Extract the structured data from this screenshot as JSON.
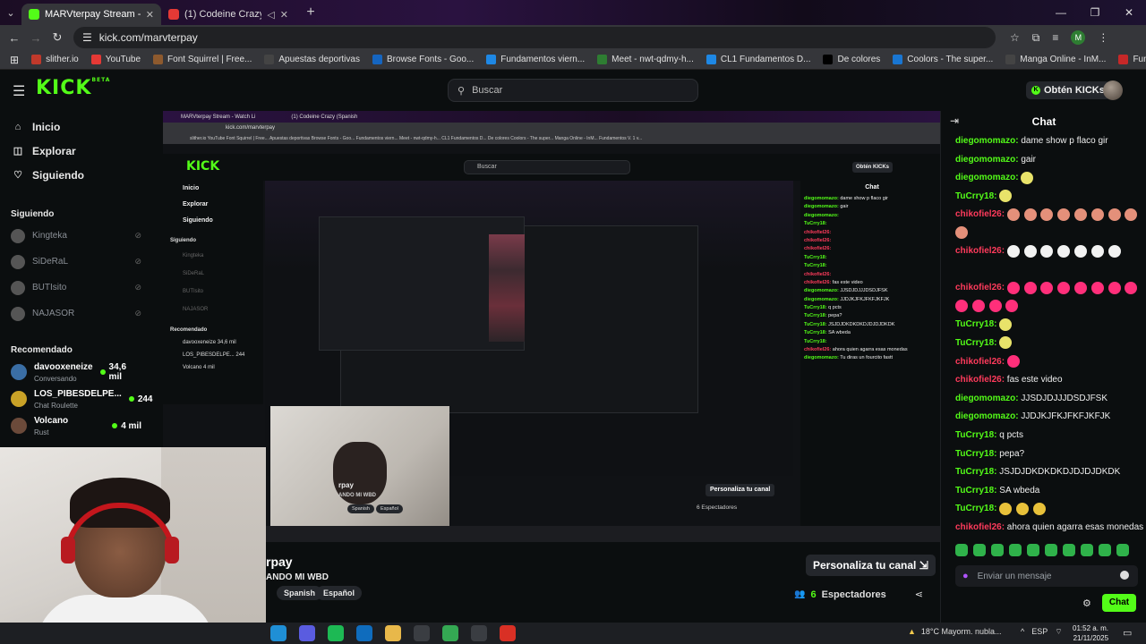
{
  "browser": {
    "tabs": [
      {
        "title": "MARVterpay Stream - Watch Li",
        "active": true
      },
      {
        "title": "(1) Codeine Crazy (Spanish",
        "active": false
      }
    ],
    "url": "kick.com/marvterpay",
    "bookmarks": [
      {
        "label": "slither.io",
        "color": "#c0392b"
      },
      {
        "label": "YouTube",
        "color": "#e53935"
      },
      {
        "label": "Font Squirrel | Free...",
        "color": "#8e5a2e"
      },
      {
        "label": "Apuestas deportivas",
        "color": "#444"
      },
      {
        "label": "Browse Fonts - Goo...",
        "color": "#1565c0"
      },
      {
        "label": "Fundamentos viern...",
        "color": "#1e88e5"
      },
      {
        "label": "Meet - nwt-qdmy-h...",
        "color": "#2e7d32"
      },
      {
        "label": "CL1 Fundamentos D...",
        "color": "#1e88e5"
      },
      {
        "label": "De colores",
        "color": "#000"
      },
      {
        "label": "Coolors - The super...",
        "color": "#1976d2"
      },
      {
        "label": "Manga Online - InM...",
        "color": "#444"
      },
      {
        "label": "Fundamentos V. 1 v...",
        "color": "#c62828"
      }
    ],
    "profile_initial": "M"
  },
  "kick": {
    "logo": "KICK",
    "logo_sup": "BETA",
    "search_placeholder": "Buscar",
    "kicks_button": "Obtén KICKs",
    "nav": [
      {
        "label": "Inicio",
        "icon": "⌂"
      },
      {
        "label": "Explorar",
        "icon": "◫"
      },
      {
        "label": "Siguiendo",
        "icon": "♡"
      }
    ],
    "following_header": "Siguiendo",
    "following": [
      "Kingteka",
      "SiDeRaL",
      "BUTIsito",
      "NAJASOR"
    ],
    "recommended_header": "Recomendado",
    "recommended": [
      {
        "name": "davooxeneize",
        "category": "Conversando",
        "viewers": "34,6 mil",
        "color": "#3a6ea5"
      },
      {
        "name": "LOS_PIBESDELPE...",
        "category": "Chat Roulette",
        "viewers": "244",
        "color": "#c9a227"
      },
      {
        "name": "Volcano",
        "category": "Rust",
        "viewers": "4 mil",
        "color": "#6b4a3a"
      }
    ]
  },
  "stream": {
    "streamer_name": "rpay",
    "title": "ANDO MI WBD",
    "tags": [
      "Spanish",
      "Español"
    ],
    "customize_button": "Personaliza tu canal",
    "viewers_count": "6",
    "viewers_label": "Espectadores"
  },
  "capture": {
    "tab1": "MARVterpay Stream - Watch Li",
    "tab2": "(1) Codeine Crazy (Spanish",
    "url": "kick.com/marvterpay",
    "bookmarks": "slither.io   YouTube   Font Squirrel | Free...   Apuestas deportivas   Browse Fonts - Goo...   Fundamentos viern...   Meet - nwt-qdmy-h...   CL1 Fundamentos D...   De colores   Coolors - The super...   Manga Online - InM...   Fundamentos V. 1 v...",
    "logo": "KICK",
    "search": "Buscar",
    "kicks": "Obtén KICKs",
    "nav": [
      "Inicio",
      "Explorar",
      "Siguiendo"
    ],
    "following_header": "Siguiendo",
    "following": [
      "Kingteka",
      "SiDeRaL",
      "BUTIsito",
      "NAJASOR"
    ],
    "recommended_header": "Recomendado",
    "recommended": [
      "davooxeneize  34,6 mil",
      "LOS_PIBESDELPE...  244",
      "Volcano  4 mil"
    ],
    "chat_title": "Chat",
    "messages": [
      {
        "user": "diegomomazo:",
        "text": " dame show p flaco gir"
      },
      {
        "user": "diegomomazo:",
        "text": " gair"
      },
      {
        "user": "diegomomazo:",
        "text": ""
      },
      {
        "user": "TuCrry18:",
        "text": ""
      },
      {
        "user": "chikofiel26:",
        "text": ""
      },
      {
        "user": "chikofiel26:",
        "text": ""
      },
      {
        "user": "chikofiel26:",
        "text": ""
      },
      {
        "user": "TuCrry18:",
        "text": ""
      },
      {
        "user": "TuCrry18:",
        "text": ""
      },
      {
        "user": "chikofiel26:",
        "text": ""
      },
      {
        "user": "chikofiel26:",
        "text": " fas este video"
      },
      {
        "user": "diegomomazo:",
        "text": " JJSDJDJJJDSDJFSK"
      },
      {
        "user": "diegomomazo:",
        "text": " JJDJKJFKJFKFJKFJK"
      },
      {
        "user": "TuCrry18:",
        "text": " q pcts"
      },
      {
        "user": "TuCrry18:",
        "text": " pepa?"
      },
      {
        "user": "TuCrry18:",
        "text": " JSJDJDKDKDKDJDJDJDKDK"
      },
      {
        "user": "TuCrry18:",
        "text": " SA wbeda"
      },
      {
        "user": "TuCrry18:",
        "text": ""
      },
      {
        "user": "chikofiel26:",
        "text": " ahora quien agarra esas monedas"
      },
      {
        "user": "diegomomazo:",
        "text": " Tu diras un fourcito fastt"
      }
    ],
    "chat_input": "Enviar un mensaje",
    "chat_send": "Chat",
    "streamer_name": "rpay",
    "title": "ANDO MI WBD",
    "tags": [
      "Spanish",
      "Español"
    ],
    "customize": "Personaliza tu canal",
    "viewers": "6 Espectadores"
  },
  "chat": {
    "title": "Chat",
    "colors": {
      "diegomomazo": "#53fc18",
      "TuCrry18": "#53fc18",
      "chikofiel26": "#ff3b5c"
    },
    "messages": [
      {
        "user": "diegomomazo:",
        "text": " dame show p flaco gir",
        "color": "#53fc18",
        "emotes": 0,
        "emote_color": ""
      },
      {
        "user": "diegomomazo:",
        "text": " gair",
        "color": "#53fc18",
        "emotes": 0,
        "emote_color": ""
      },
      {
        "user": "diegomomazo:",
        "text": "",
        "color": "#53fc18",
        "emotes": 1,
        "emote_color": "#e8e36a"
      },
      {
        "user": "TuCrry18:",
        "text": "",
        "color": "#53fc18",
        "emotes": 1,
        "emote_color": "#e8e36a"
      },
      {
        "user": "chikofiel26:",
        "text": "",
        "color": "#ff3b5c",
        "emotes": 9,
        "emote_color": "#e4907a"
      },
      {
        "user": "chikofiel26:",
        "text": "",
        "color": "#ff3b5c",
        "emotes": 7,
        "emote_color": "#f2f2f2"
      },
      {
        "user": "chikofiel26:",
        "text": "",
        "color": "#ff3b5c",
        "emotes": 12,
        "emote_color": "#ff2f7a"
      },
      {
        "user": "TuCrry18:",
        "text": "",
        "color": "#53fc18",
        "emotes": 1,
        "emote_color": "#e8e36a"
      },
      {
        "user": "TuCrry18:",
        "text": "",
        "color": "#53fc18",
        "emotes": 1,
        "emote_color": "#e8e36a"
      },
      {
        "user": "chikofiel26:",
        "text": "",
        "color": "#ff3b5c",
        "emotes": 1,
        "emote_color": "#ff2f7a"
      },
      {
        "user": "chikofiel26:",
        "text": " fas este video",
        "color": "#ff3b5c",
        "emotes": 0,
        "emote_color": ""
      },
      {
        "user": "diegomomazo:",
        "text": " JJSDJDJJJDSDJFSK",
        "color": "#53fc18",
        "emotes": 0,
        "emote_color": ""
      },
      {
        "user": "diegomomazo:",
        "text": " JJDJKJFKJFKFJKFJK",
        "color": "#53fc18",
        "emotes": 0,
        "emote_color": ""
      },
      {
        "user": "TuCrry18:",
        "text": " q pcts",
        "color": "#53fc18",
        "emotes": 0,
        "emote_color": ""
      },
      {
        "user": "TuCrry18:",
        "text": " pepa?",
        "color": "#53fc18",
        "emotes": 0,
        "emote_color": ""
      },
      {
        "user": "TuCrry18:",
        "text": " JSJDJDKDKDKDJDJDJDKDK",
        "color": "#53fc18",
        "emotes": 0,
        "emote_color": ""
      },
      {
        "user": "TuCrry18:",
        "text": " SA wbeda",
        "color": "#53fc18",
        "emotes": 0,
        "emote_color": ""
      },
      {
        "user": "TuCrry18:",
        "text": "",
        "color": "#53fc18",
        "emotes": 3,
        "emote_color": "#e8c13a"
      },
      {
        "user": "chikofiel26:",
        "text": " ahora quien agarra esas monedas",
        "color": "#ff3b5c",
        "emotes": 0,
        "emote_color": ""
      },
      {
        "user": "diegomomazo:",
        "text": " Tu diras un fourcito fastt",
        "color": "#53fc18",
        "emotes": 0,
        "emote_color": ""
      }
    ],
    "input_placeholder": "Enviar un mensaje",
    "send_label": "Chat"
  },
  "taskbar": {
    "apps": [
      "#1f8fd6",
      "#5a5ce0",
      "#1db954",
      "#0f6cbd",
      "#e8b84a",
      "#3a3d42",
      "#34a853",
      "#3a3d42",
      "#d93025"
    ],
    "weather": "18°C  Mayorm. nubla...",
    "lang": "ESP",
    "time": "01:52 a. m.",
    "date": "21/11/2025"
  }
}
